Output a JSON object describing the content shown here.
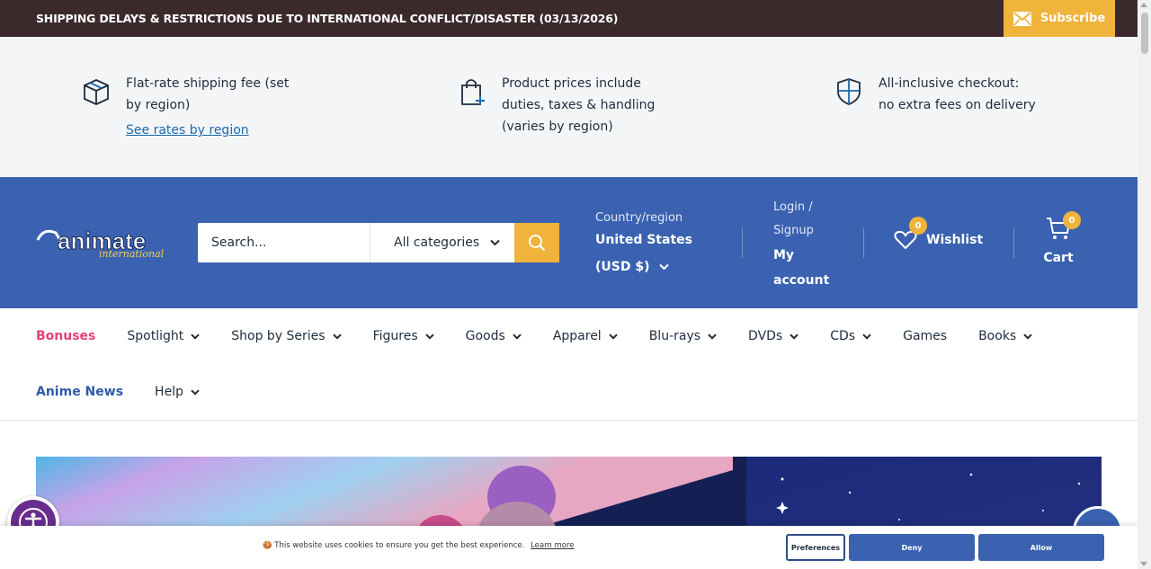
{
  "announcement": {
    "text": "SHIPPING DELAYS & RESTRICTIONS DUE TO INTERNATIONAL CONFLICT/DISASTER (03/13/2026)",
    "subscribe_label": "Subscribe"
  },
  "benefits": [
    {
      "text": "Flat-rate shipping fee (set by region)",
      "link": "See rates by region",
      "icon": "box-icon"
    },
    {
      "text": "Product prices include duties, taxes & handling (varies by region)",
      "icon": "shopping-bag-plus-icon"
    },
    {
      "text": "All-inclusive checkout: no extra fees on delivery",
      "icon": "shield-icon"
    }
  ],
  "header": {
    "logo_text": "animate",
    "logo_subtext": "international",
    "search_placeholder": "Search...",
    "category_label": "All categories",
    "country_label": "Country/region",
    "country_value": "United States (USD $)",
    "account_label": "Login / Signup",
    "account_value": "My account",
    "wishlist_label": "Wishlist",
    "wishlist_count": "0",
    "cart_label": "Cart",
    "cart_count": "0"
  },
  "nav": {
    "row1": [
      {
        "label": "Bonuses",
        "dropdown": false
      },
      {
        "label": "Spotlight",
        "dropdown": true
      },
      {
        "label": "Shop by Series",
        "dropdown": true
      },
      {
        "label": "Figures",
        "dropdown": true
      },
      {
        "label": "Goods",
        "dropdown": true
      },
      {
        "label": "Apparel",
        "dropdown": true
      },
      {
        "label": "Blu-rays",
        "dropdown": true
      },
      {
        "label": "DVDs",
        "dropdown": true
      },
      {
        "label": "CDs",
        "dropdown": true
      },
      {
        "label": "Games",
        "dropdown": false
      },
      {
        "label": "Books",
        "dropdown": true
      }
    ],
    "row2": [
      {
        "label": "Anime News",
        "dropdown": false
      },
      {
        "label": "Help",
        "dropdown": true
      }
    ]
  },
  "cookie": {
    "text": "This website uses cookies to ensure you get the best experience.",
    "learn_more": "Learn more",
    "preferences": "Preferences",
    "deny": "Deny",
    "allow": "Allow"
  },
  "colors": {
    "header": "#3a62b0",
    "accent": "#f0b33b",
    "announcement": "#3a2a2b",
    "bonus": "#e5417a"
  }
}
